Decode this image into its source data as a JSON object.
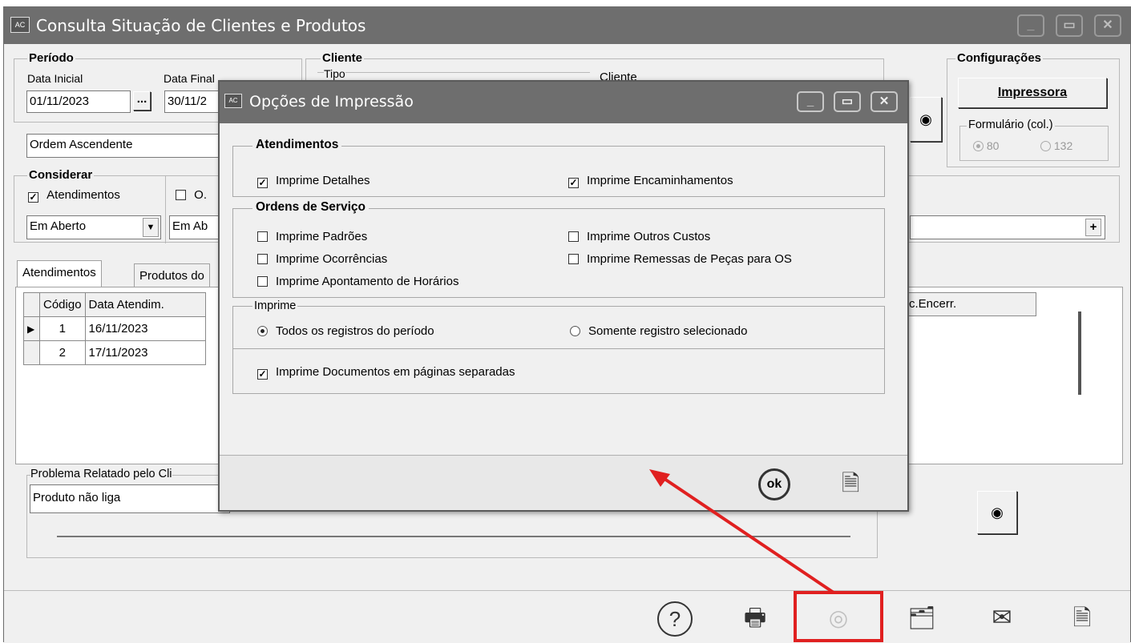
{
  "window": {
    "title": "Consulta Situação de Clientes e Produtos",
    "app_badge": "AC"
  },
  "periodo": {
    "label": "Período",
    "data_inicial_label": "Data Inicial",
    "data_inicial": "01/11/2023",
    "data_final_label": "Data Final",
    "data_final": "30/11/2",
    "date_button": "...",
    "ordem": "Ordem Ascendente"
  },
  "cliente": {
    "label": "Cliente",
    "tipo_label": "Tipo",
    "cliente_label": "Cliente"
  },
  "configuracoes": {
    "label": "Configurações",
    "impressora": "Impressora",
    "formulario_label": "Formulário (col.)",
    "opt80": "80",
    "opt132": "132"
  },
  "considerar": {
    "label": "Considerar",
    "atendimentos": "Atendimentos",
    "os": "O.",
    "status1": "Em Aberto",
    "status2": "Em Ab",
    "plus": "+"
  },
  "tabs": [
    {
      "label": "Atendimentos"
    },
    {
      "label": "Produtos do"
    }
  ],
  "grid": {
    "col_codigo": "Código",
    "col_data": "Data Atendim.",
    "col_encerr": "c.Encerr.",
    "rows": [
      {
        "codigo": "1",
        "data": "16/11/2023"
      },
      {
        "codigo": "2",
        "data": "17/11/2023"
      }
    ]
  },
  "problema": {
    "label": "Problema Relatado pelo Cli",
    "text": "Produto não liga"
  },
  "dialog": {
    "title": "Opções de Impressão",
    "badge": "AC",
    "atendimentos": {
      "label": "Atendimentos",
      "detalhes": "Imprime Detalhes",
      "encaminhamentos": "Imprime Encaminhamentos"
    },
    "ordens": {
      "label": "Ordens de Serviço",
      "padroes": "Imprime Padrões",
      "outros_custos": "Imprime Outros Custos",
      "ocorrencias": "Imprime Ocorrências",
      "remessas": "Imprime Remessas de Peças para OS",
      "apontamento": "Imprime Apontamento de Horários"
    },
    "imprime": {
      "label": "Imprime",
      "todos": "Todos os registros do período",
      "somente": "Somente registro selecionado"
    },
    "separadas": "Imprime Documentos em páginas separadas",
    "ok": "ok"
  },
  "icons": {
    "help": "question-icon",
    "print": "printer-icon",
    "preview": "eye-icon",
    "folder": "folder-icon",
    "mail": "envelope-icon",
    "close": "document-close-icon"
  },
  "colors": {
    "titlebar": "#6e6e6e",
    "annotation": "#e02020",
    "background": "#f0f0f0"
  }
}
